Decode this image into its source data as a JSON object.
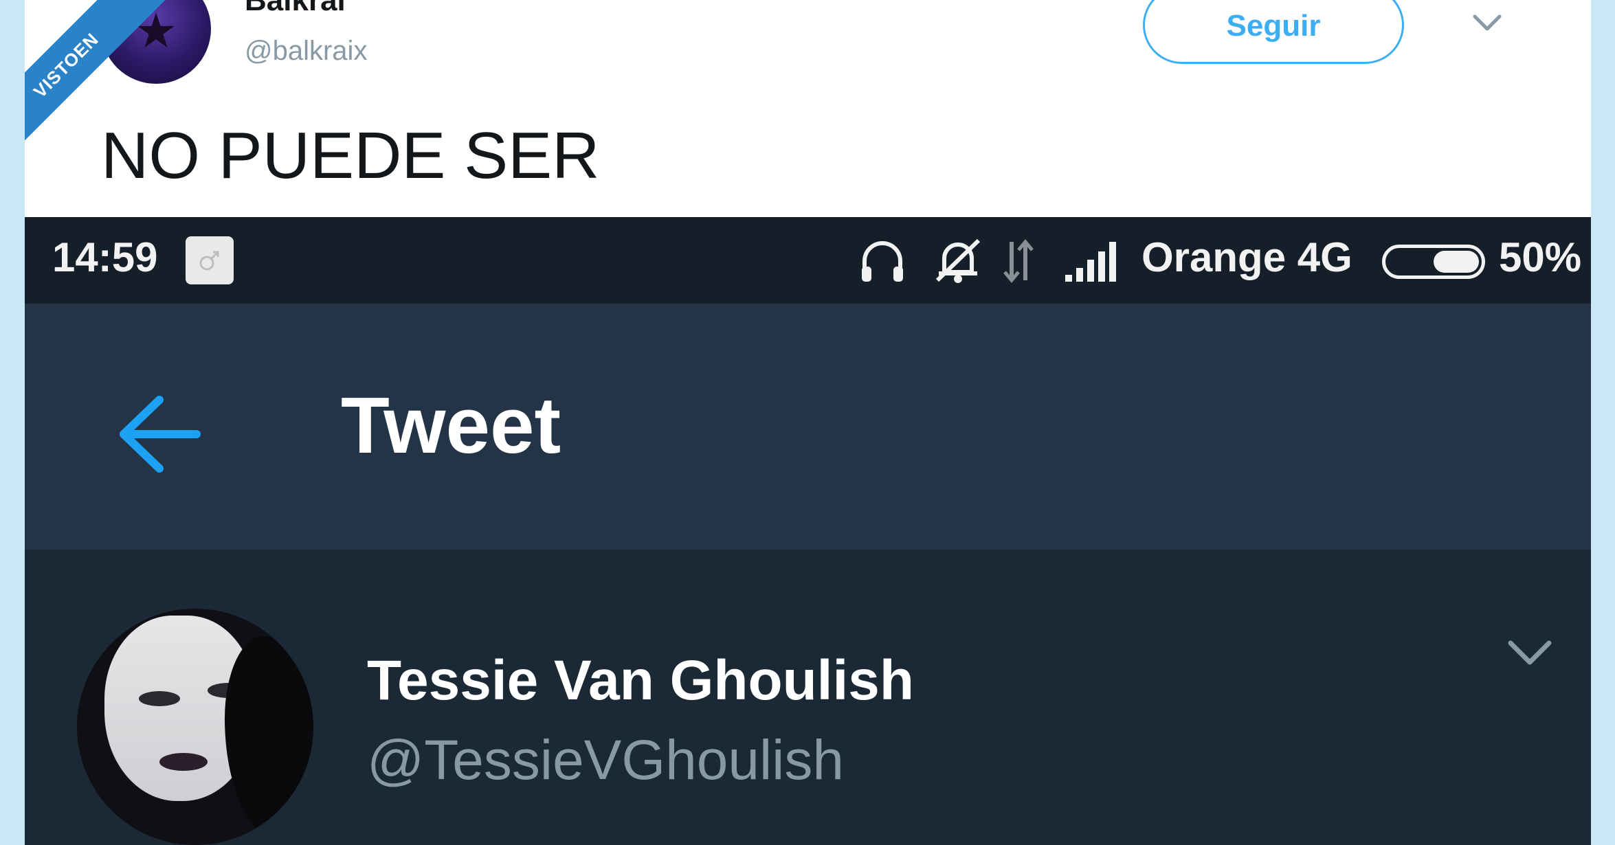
{
  "overlay": {
    "badge_text": "VISTOEN"
  },
  "outer_tweet": {
    "name": "Balkrai",
    "handle": "@balkraix",
    "follow_label": "Seguir",
    "text": "NO PUEDE SER"
  },
  "status_bar": {
    "time": "14:59",
    "carrier": "Orange 4G",
    "battery_percent_label": "50%",
    "battery_level": 0.5,
    "icons": [
      "notification-icon",
      "headphones-icon",
      "mute-bell-icon",
      "data-arrows-icon",
      "signal-icon"
    ]
  },
  "app_bar": {
    "title": "Tweet",
    "back_icon": "back-arrow-icon"
  },
  "inner_tweet": {
    "name": "Tessie Van Ghoulish",
    "handle": "@TessieVGhoulish",
    "menu_icon": "chevron-down-icon"
  },
  "colors": {
    "twitter_blue": "#1da1f2",
    "dark_bg": "#1b2836",
    "appbar_bg": "#243447",
    "statusbar_bg": "#151f2a",
    "handle_grey": "#8899a6",
    "frame_blue": "#c9e7f5"
  }
}
